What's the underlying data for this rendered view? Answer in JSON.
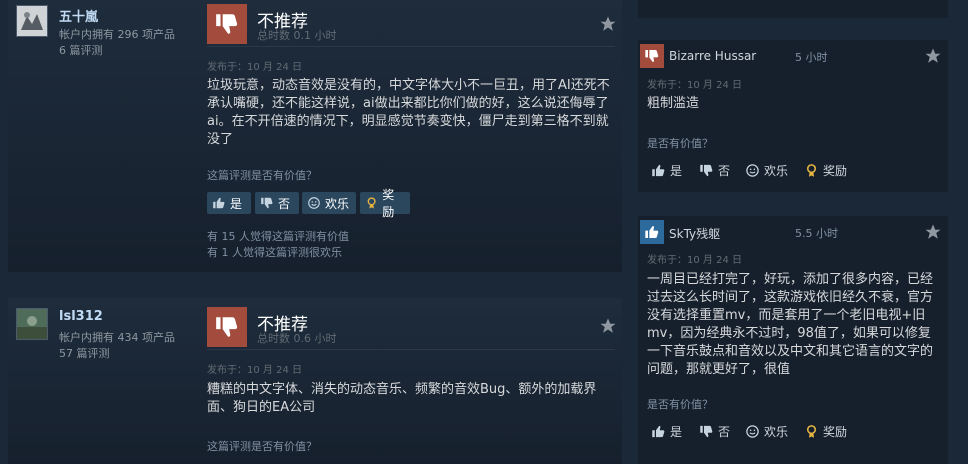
{
  "review1": {
    "username": "五十嵐",
    "owned": "帐户内拥有 296 项产品",
    "reviews": "6 篇评测",
    "verdict": "不推荐",
    "hours": "总时数 0.1 小时",
    "date": "发布于：10 月 24 日",
    "text": "垃圾玩意，动态音效是没有的，中文字体大小不一巨丑，用了AI还死不承认嘴硬，还不能这样说，ai做出来都比你们做的好，这么说还侮辱了ai。在不开倍速的情况下，明显感觉节奏变快，僵尸走到第三格不到就没了",
    "helpful_q": "这篇评测是否有价值？",
    "yes": "是",
    "no": "否",
    "funny": "欢乐",
    "award": "奖励",
    "votes1": "有 15 人觉得这篇评测有价值",
    "votes2": "有 1 人觉得这篇评测很欢乐"
  },
  "review2": {
    "username": "lsl312",
    "owned": "帐户内拥有 434 项产品",
    "reviews": "57 篇评测",
    "verdict": "不推荐",
    "hours": "总时数 0.6 小时",
    "date": "发布于：10 月 24 日",
    "text": "糟糕的中文字体、消失的动态音乐、频繁的音效Bug、额外的加载界面、狗日的EA公司",
    "helpful_q": "这篇评测是否有价值？"
  },
  "side1": {
    "username": "Bizarre Hussar",
    "hours": "5 小时",
    "date": "发布于：10 月 24 日",
    "text": "粗制滥造",
    "helpful_q": "是否有价值？",
    "yes": "是",
    "no": "否",
    "funny": "欢乐",
    "award": "奖励"
  },
  "side2": {
    "username": "SkTy残躯",
    "hours": "5.5 小时",
    "date": "发布于：10 月 24 日",
    "text": "一周目已经打完了，好玩，添加了很多内容，已经过去这么长时间了，这款游戏依旧经久不衰，官方没有选择重置mv，而是套用了一个老旧电视+旧mv，因为经典永不过时，98值了，如果可以修复一下音乐鼓点和音效以及中文和其它语言的文字的问题，那就更好了，很值",
    "helpful_q": "是否有价值？",
    "yes": "是",
    "no": "否",
    "funny": "欢乐",
    "award": "奖励"
  },
  "colors": {
    "background": "#1b2838",
    "thumbs_down": "#a34c3d",
    "thumbs_up": "#2c6a9c"
  },
  "icons": [
    "thumbs-down-icon",
    "thumbs-up-icon",
    "star-icon",
    "smiley-icon",
    "award-icon"
  ]
}
